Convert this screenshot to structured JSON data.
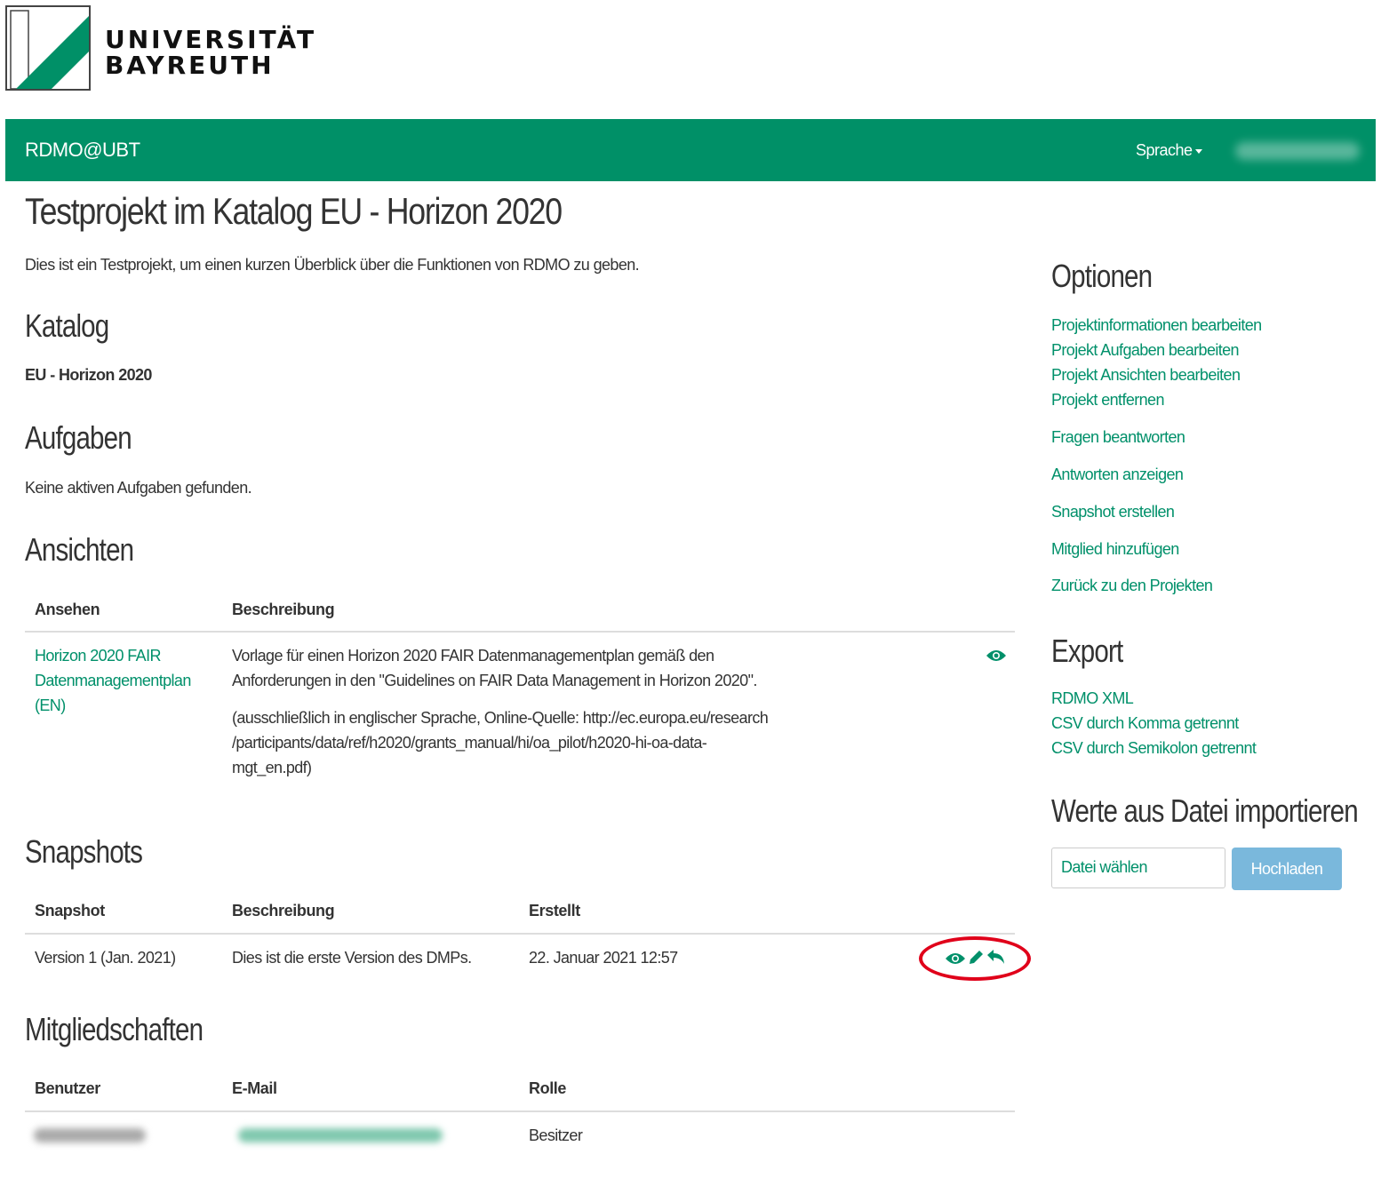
{
  "logo": {
    "line1": "UNIVERSITÄT",
    "line2": "BAYREUTH"
  },
  "navbar": {
    "brand": "RDMO@UBT",
    "language_label": "Sprache"
  },
  "project": {
    "title": "Testprojekt im Katalog EU - Horizon 2020",
    "description": "Dies ist ein Testprojekt, um einen kurzen Überblick über die Funktionen von RDMO zu geben."
  },
  "catalog": {
    "heading": "Katalog",
    "value": "EU - Horizon 2020"
  },
  "tasks": {
    "heading": "Aufgaben",
    "empty": "Keine aktiven Aufgaben gefunden."
  },
  "views": {
    "heading": "Ansichten",
    "columns": [
      "Ansehen",
      "Beschreibung"
    ],
    "rows": [
      {
        "name_lines": [
          "Horizon 2020 FAIR",
          "Datenmanagementplan",
          "(EN)"
        ],
        "desc_lines": [
          "Vorlage für einen Horizon 2020 FAIR Datenmanagementplan gemäß den",
          "Anforderungen in den \"Guidelines on FAIR Data Management in Horizon 2020\"."
        ],
        "note_lines": [
          "(ausschließlich in englischer Sprache, Online-Quelle: http://ec.europa.eu/research",
          "/participants/data/ref/h2020/grants_manual/hi/oa_pilot/h2020-hi-oa-data-",
          "mgt_en.pdf)"
        ],
        "action_icon": "eye-icon"
      }
    ]
  },
  "snapshots": {
    "heading": "Snapshots",
    "columns": [
      "Snapshot",
      "Beschreibung",
      "Erstellt"
    ],
    "rows": [
      {
        "name": "Version 1 (Jan. 2021)",
        "description": "Dies ist die erste Version des DMPs.",
        "created": "22. Januar 2021 12:57",
        "action_icons": [
          "eye-icon",
          "pencil-icon",
          "rollback-icon"
        ]
      }
    ]
  },
  "memberships": {
    "heading": "Mitgliedschaften",
    "columns": [
      "Benutzer",
      "E-Mail",
      "Rolle"
    ],
    "rows": [
      {
        "role": "Besitzer"
      }
    ]
  },
  "sidebar": {
    "options_heading": "Optionen",
    "options": [
      "Projektinformationen bearbeiten",
      "Projekt Aufgaben bearbeiten",
      "Projekt Ansichten bearbeiten",
      "Projekt entfernen",
      "Fragen beantworten",
      "Antworten anzeigen",
      "Snapshot erstellen",
      "Mitglied hinzufügen",
      "Zurück zu den Projekten"
    ],
    "export_heading": "Export",
    "exports": [
      "RDMO XML",
      "CSV durch Komma getrennt",
      "CSV durch Semikolon getrennt"
    ],
    "import_heading": "Werte aus Datei importieren",
    "file_input_label": "Datei wählen",
    "upload_label": "Hochladen"
  },
  "colors": {
    "brand_green": "#009067",
    "link_green": "#00906a",
    "upload_button": "#7ab8dc",
    "highlight": "#e0001a"
  }
}
